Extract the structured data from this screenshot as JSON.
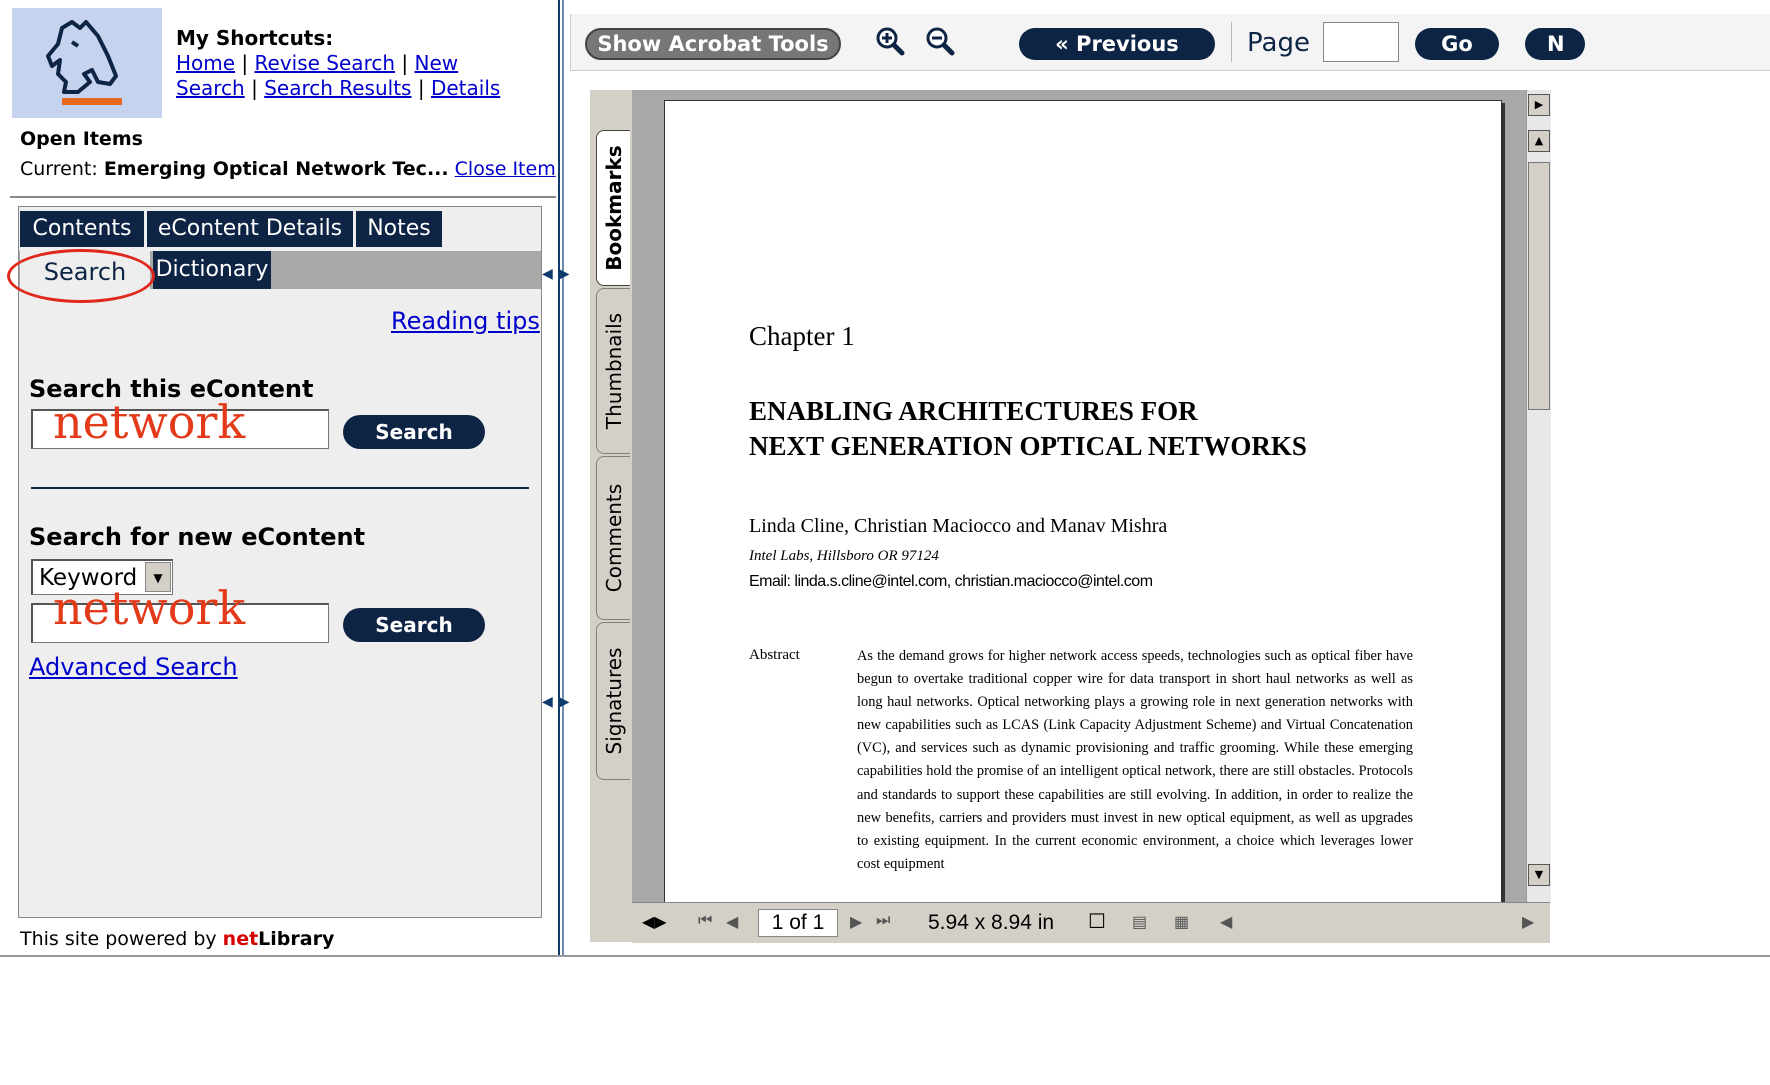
{
  "shortcuts": {
    "title": "My Shortcuts:",
    "home": "Home",
    "revise_search": "Revise Search",
    "new_search": "New Search",
    "new": "New",
    "search": "Search",
    "search_results": "Search Results",
    "details": "Details",
    "sep": "|"
  },
  "open_items": {
    "heading": "Open Items",
    "current_label": "Current:",
    "current_value": "Emerging Optical Network Tec...",
    "close_label": "Close Item"
  },
  "tabs": {
    "contents": "Contents",
    "econtent_details": "eContent Details",
    "notes": "Notes",
    "search": "Search",
    "dictionary": "Dictionary"
  },
  "search_panel": {
    "reading_tips": "Reading tips",
    "search_this_label": "Search this eContent",
    "search_this_value": "network",
    "search_button": "Search",
    "search_new_label": "Search for new eContent",
    "type_select": "Keyword",
    "search_new_value": "network",
    "advanced_search": "Advanced Search"
  },
  "footer": {
    "powered_prefix": "This site powered by",
    "brand_net": "net",
    "brand_library": "Library"
  },
  "toolbar": {
    "show_acrobat_tools": "Show Acrobat Tools",
    "previous": "« Previous",
    "page_label": "Page",
    "page_value": "",
    "go": "Go",
    "next_partial": "N",
    "zoom_in_icon": "zoom-in-icon",
    "zoom_out_icon": "zoom-out-icon"
  },
  "side_tabs": {
    "bookmarks": "Bookmarks",
    "thumbnails": "Thumbnails",
    "comments": "Comments",
    "signatures": "Signatures"
  },
  "document": {
    "chapter": "Chapter 1",
    "title_line1": "ENABLING ARCHITECTURES FOR",
    "title_line2": "NEXT GENERATION OPTICAL NETWORKS",
    "authors": "Linda Cline, Christian Maciocco and Manav Mishra",
    "affiliation": "Intel Labs, Hillsboro OR 97124",
    "email": "Email: linda.s.cline@intel.com, christian.maciocco@intel.com",
    "abstract_label": "Abstract",
    "abstract_text": "As the demand grows for higher network access speeds, technologies such as optical fiber have begun to overtake traditional copper wire for data transport in short haul networks as well as long haul networks. Optical networking plays a growing role in next generation networks with new capabilities such as LCAS (Link Capacity Adjustment Scheme) and Virtual Concatenation (VC), and services such as dynamic provisioning and traffic grooming. While these emerging capabilities hold the promise of an intelligent optical network, there are still obstacles. Protocols and standards to support these capabilities are still evolving. In addition, in order to realize the new benefits, carriers and providers must invest in new optical equipment, as well as upgrades to existing equipment. In the current economic environment, a choice which leverages lower cost equipment"
  },
  "status": {
    "page_of": "1 of 1",
    "page_size": "5.94 x 8.94 in"
  },
  "colors": {
    "nav_dark": "#0e2444",
    "annotation_red": "#e33a19",
    "link_blue": "#0000cc"
  }
}
